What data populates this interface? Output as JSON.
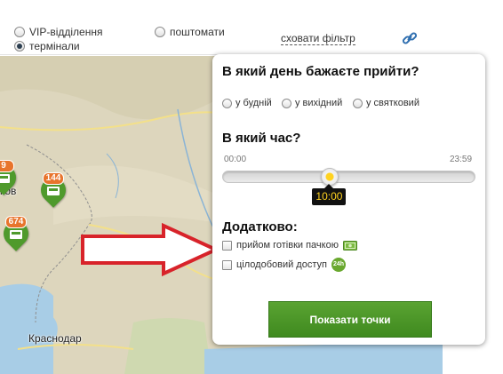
{
  "filter": {
    "options": [
      {
        "label": "VIP-відділення",
        "checked": false
      },
      {
        "label": "поштомати",
        "checked": false
      },
      {
        "label": "термінали",
        "checked": true
      }
    ],
    "hide_filter_label": "сховати фільтр",
    "link_icon": "link-icon"
  },
  "map": {
    "cities": [
      "Краснодар",
      "ков"
    ],
    "markers": [
      {
        "count": "9"
      },
      {
        "count": "144"
      },
      {
        "count": "674"
      }
    ],
    "colors": {
      "marker": "#4f9a2c",
      "badge": "#e8742c",
      "arrow": "#d8232a"
    }
  },
  "popup": {
    "day_title": "В який день бажаєте прийти?",
    "day_options": [
      {
        "label": "у будній",
        "checked": false
      },
      {
        "label": "у вихідний",
        "checked": false
      },
      {
        "label": "у святковий",
        "checked": false
      }
    ],
    "time_title": "В який час?",
    "time_min": "00:00",
    "time_max": "23:59",
    "time_value": "10:00",
    "time_fraction": 0.4167,
    "extra_title": "Додатково:",
    "extras": [
      {
        "label": "прийом готівки пачкою",
        "checked": false,
        "icon": "cash-icon"
      },
      {
        "label": "цілодобовий доступ",
        "checked": false,
        "icon": "24h-icon",
        "icon_text": "24h"
      }
    ],
    "show_button": "Показати точки",
    "accent": "#ffd21f",
    "button_color": "#4f9a2c"
  }
}
